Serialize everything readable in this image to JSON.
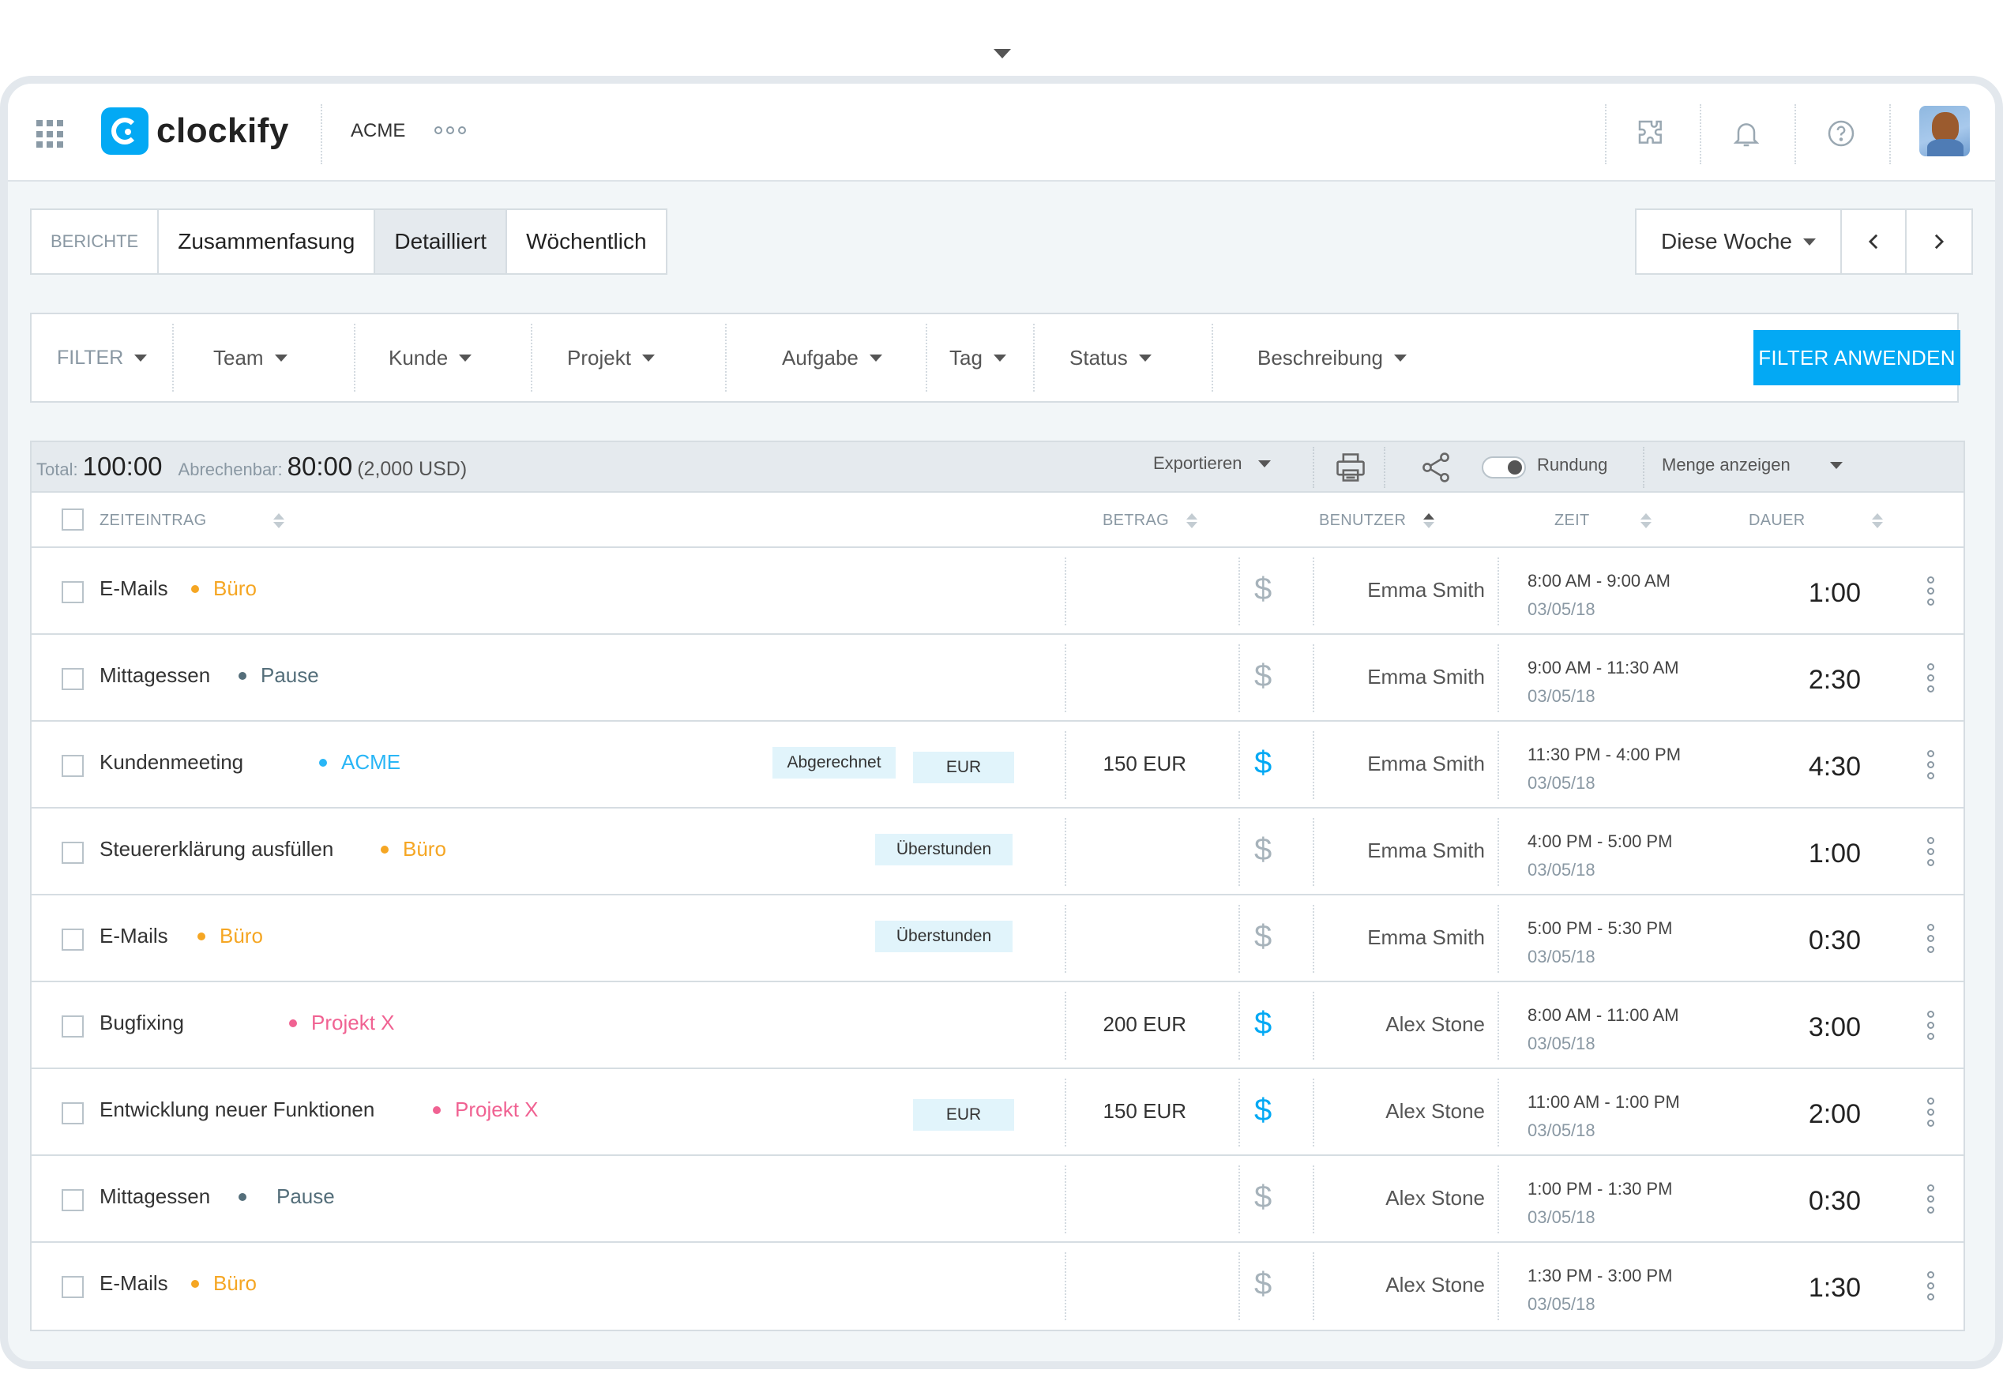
{
  "header": {
    "app_name": "clockify",
    "workspace": "ACME"
  },
  "tabs": [
    {
      "label": "BERICHTE",
      "active": false
    },
    {
      "label": "Zusammenfasung",
      "active": false
    },
    {
      "label": "Detailliert",
      "active": true
    },
    {
      "label": "Wöchentlich",
      "active": false
    }
  ],
  "date_range": {
    "label": "Diese Woche"
  },
  "filters": {
    "label": "FILTER",
    "items": [
      "Team",
      "Kunde",
      "Projekt",
      "Aufgabe",
      "Tag",
      "Status",
      "Beschreibung"
    ],
    "apply_label": "FILTER ANWENDEN"
  },
  "summary": {
    "total_label": "Total:",
    "total_value": "100:00",
    "billable_label": "Abrechenbar:",
    "billable_value": "80:00",
    "billable_amount": "(2,000 USD)",
    "export_label": "Exportieren",
    "rounding_label": "Rundung",
    "show_amount_label": "Menge anzeigen"
  },
  "table": {
    "columns": {
      "entry": "ZEITEINTRAG",
      "amount": "BETRAG",
      "user": "BENUTZER",
      "time": "ZEIT",
      "duration": "DAUER"
    },
    "rows": [
      {
        "desc": "E-Mails",
        "project": "Büro",
        "color": "#f5a623",
        "tags": [],
        "amount": "",
        "billable": false,
        "user": "Emma Smith",
        "time": "8:00 AM - 9:00 AM",
        "date": "03/05/18",
        "duration": "1:00"
      },
      {
        "desc": "Mittagessen",
        "project": "Pause",
        "color": "#546e7a",
        "tags": [],
        "amount": "",
        "billable": false,
        "user": "Emma Smith",
        "time": "9:00 AM - 11:30 AM",
        "date": "03/05/18",
        "duration": "2:30"
      },
      {
        "desc": "Kundenmeeting",
        "project": "ACME",
        "color": "#29b6f6",
        "tags": [
          "Abgerechnet",
          "EUR"
        ],
        "amount": "150 EUR",
        "billable": true,
        "user": "Emma Smith",
        "time": "11:30 PM - 4:00 PM",
        "date": "03/05/18",
        "duration": "4:30"
      },
      {
        "desc": "Steuererklärung ausfüllen",
        "project": "Büro",
        "color": "#f5a623",
        "tags": [
          "Überstunden"
        ],
        "amount": "",
        "billable": false,
        "user": "Emma Smith",
        "time": "4:00 PM - 5:00 PM",
        "date": "03/05/18",
        "duration": "1:00"
      },
      {
        "desc": "E-Mails",
        "project": "Büro",
        "color": "#f5a623",
        "tags": [
          "Überstunden"
        ],
        "amount": "",
        "billable": false,
        "user": "Emma Smith",
        "time": "5:00 PM - 5:30 PM",
        "date": "03/05/18",
        "duration": "0:30"
      },
      {
        "desc": "Bugfixing",
        "project": "Projekt X",
        "color": "#f06292",
        "tags": [],
        "amount": "200 EUR",
        "billable": true,
        "user": "Alex Stone",
        "time": "8:00 AM - 11:00 AM",
        "date": "03/05/18",
        "duration": "3:00"
      },
      {
        "desc": "Entwicklung neuer Funktionen",
        "project": "Projekt X",
        "color": "#f06292",
        "tags": [
          "EUR"
        ],
        "amount": "150 EUR",
        "billable": true,
        "user": "Alex Stone",
        "time": "11:00 AM - 1:00 PM",
        "date": "03/05/18",
        "duration": "2:00"
      },
      {
        "desc": "Mittagessen",
        "project": "Pause",
        "color": "#546e7a",
        "tags": [],
        "amount": "",
        "billable": false,
        "user": "Alex Stone",
        "time": "1:00 PM - 1:30 PM",
        "date": "03/05/18",
        "duration": "0:30"
      },
      {
        "desc": "E-Mails",
        "project": "Büro",
        "color": "#f5a623",
        "tags": [],
        "amount": "",
        "billable": false,
        "user": "Alex Stone",
        "time": "1:30 PM - 3:00 PM",
        "date": "03/05/18",
        "duration": "1:30"
      }
    ]
  }
}
